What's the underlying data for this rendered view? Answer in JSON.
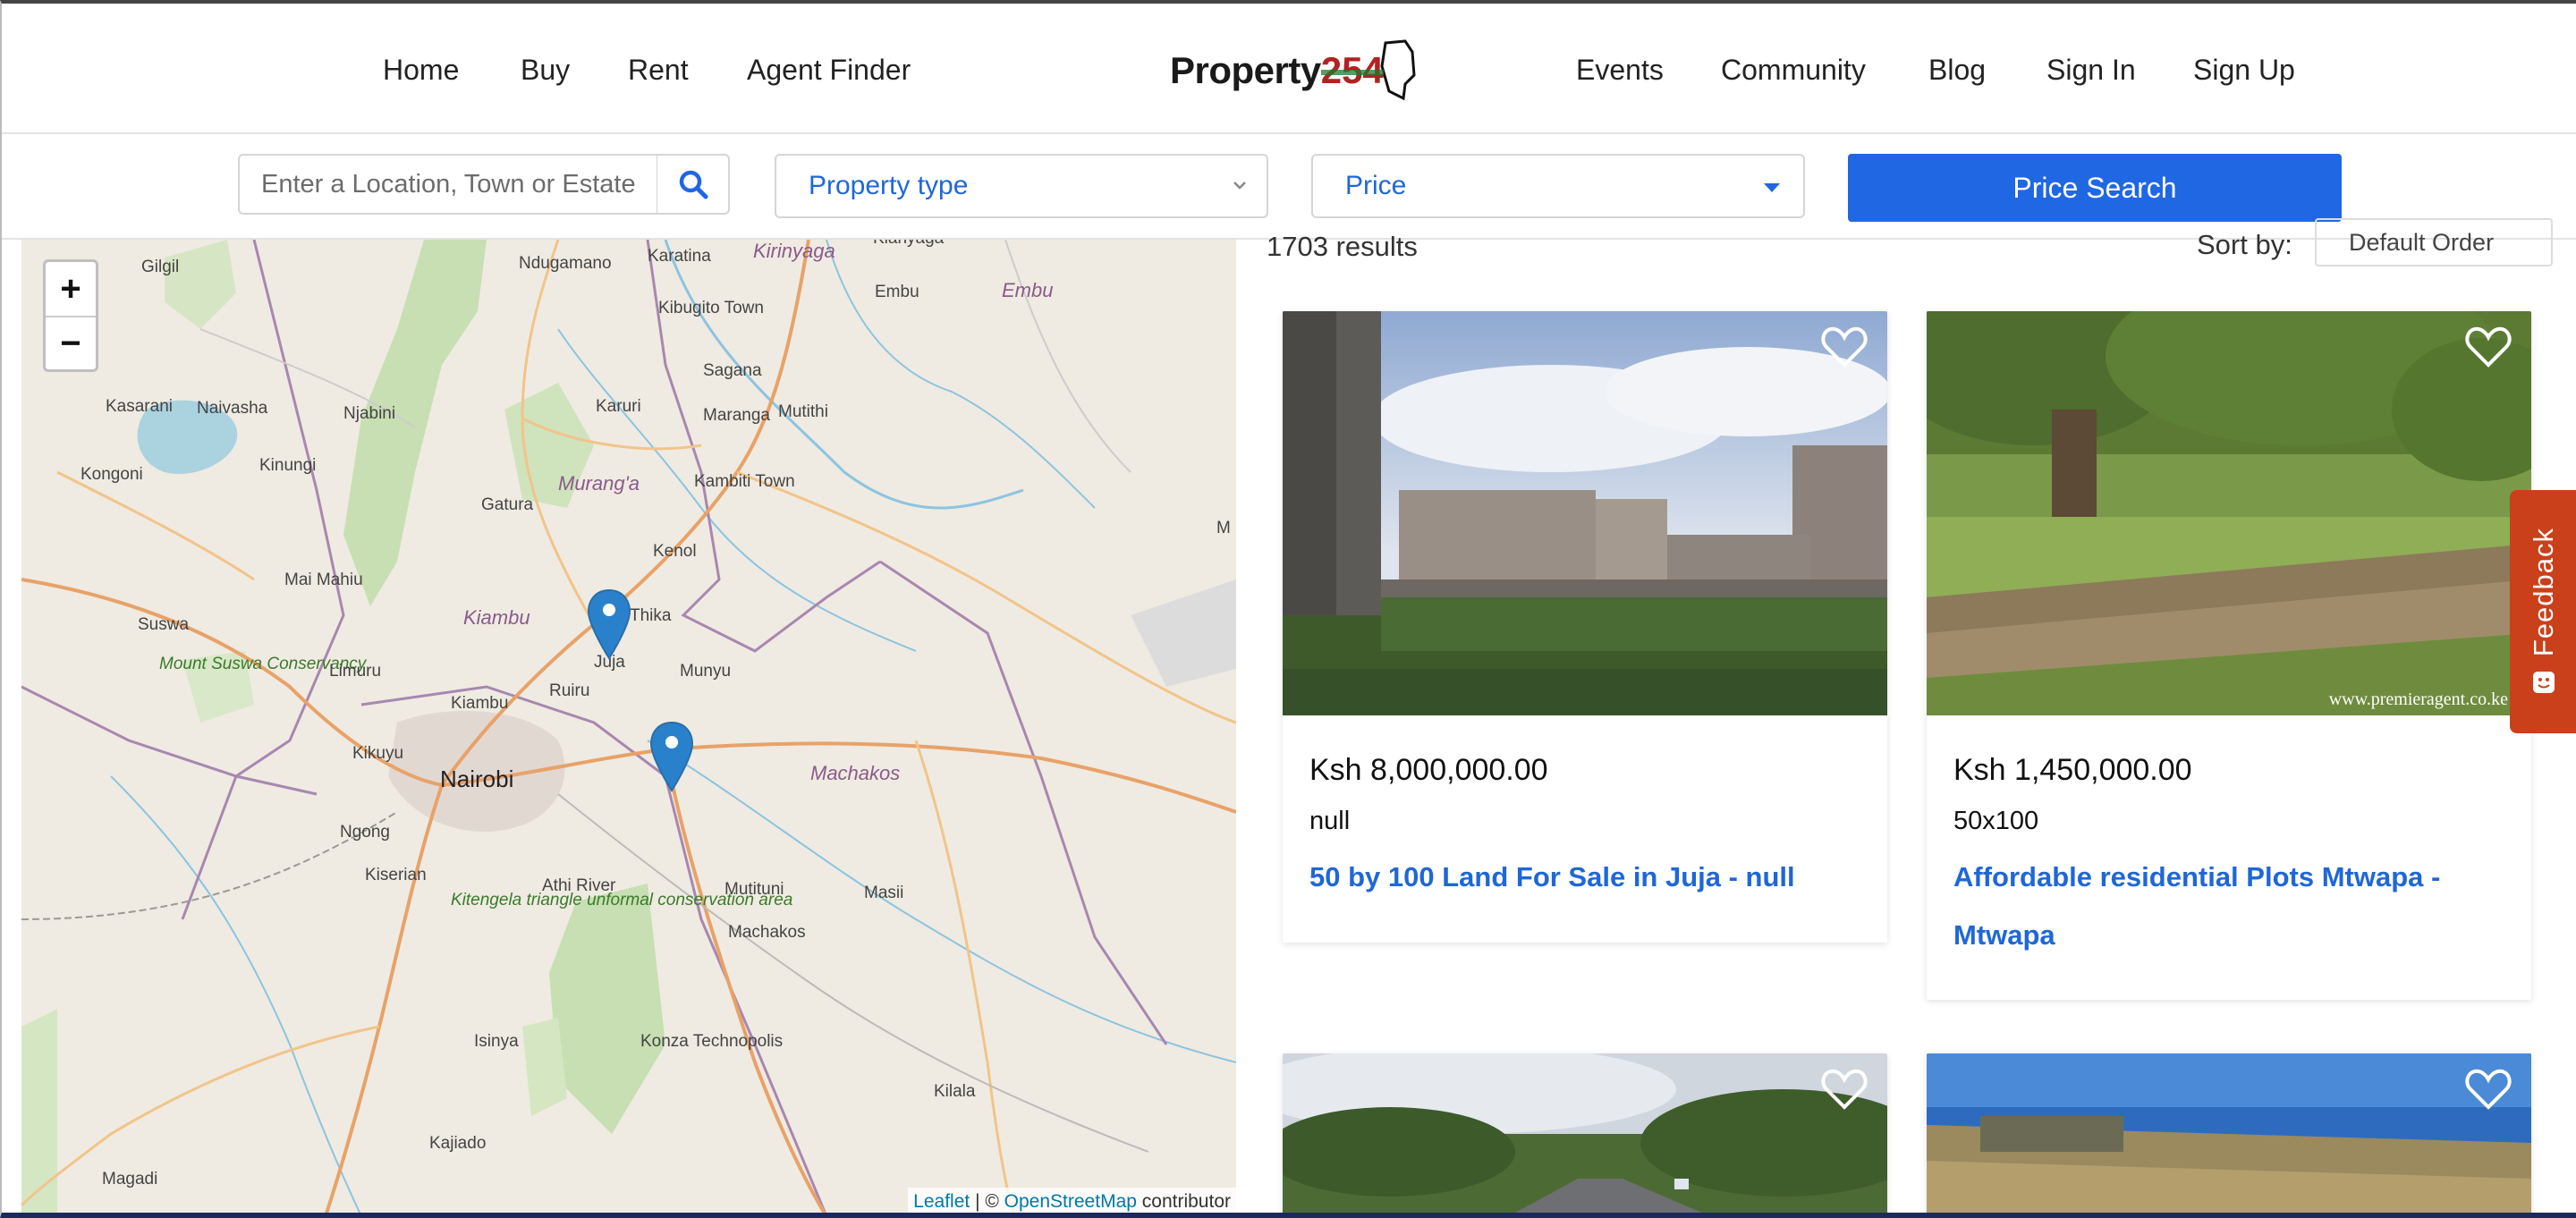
{
  "nav": {
    "left": [
      "Home",
      "Buy",
      "Rent",
      "Agent Finder"
    ],
    "right": [
      "Events",
      "Community",
      "Blog",
      "Sign In",
      "Sign Up"
    ],
    "logo_text": "Property",
    "logo_num": "254"
  },
  "search": {
    "location_placeholder": "Enter a Location, Town or Estate",
    "property_type": "Property type",
    "price": "Price",
    "price_search_label": "Price Search"
  },
  "map": {
    "zoom_in": "+",
    "zoom_out": "−",
    "places": {
      "ndugamano": "Ndugamano",
      "karatina": "Karatina",
      "kirinyaga": "Kirinyaga",
      "kianyaga": "Kianyaga",
      "embu_town": "Embu",
      "embu_county": "Embu",
      "kibugito": "Kibugito Town",
      "gilgil": "Gilgil",
      "kasarani": "Kasarani",
      "naivasha": "Naivasha",
      "njabini": "Njabini",
      "karuri": "Karuri",
      "maranga": "Maranga",
      "sagana": "Sagana",
      "mutithi": "Mutithi",
      "kongoni": "Kongoni",
      "kinungi": "Kinungi",
      "gatura": "Gatura",
      "muranga": "Murang'a",
      "kambiti": "Kambiti Town",
      "mwingi": "M",
      "kenol": "Kenol",
      "mai_mahiu": "Mai Mahiu",
      "kiambu_county": "Kiambu",
      "thika": "Thika",
      "suswa": "Suswa",
      "suswa_park": "Mount Suswa Conservancy",
      "limuru": "Limuru",
      "juja": "Juja",
      "ruiru": "Ruiru",
      "munyu": "Munyu",
      "kiambu": "Kiambu",
      "kikuyu": "Kikuyu",
      "nairobi": "Nairobi",
      "machakos_county": "Machakos",
      "ngong": "Ngong",
      "kiserian": "Kiserian",
      "athi_river": "Athi River",
      "kitengela": "Kitengela triangle unformal conservation area",
      "mutituni": "Mutituni",
      "masii": "Masii",
      "machakos": "Machakos",
      "isinya": "Isinya",
      "konza": "Konza Technopolis",
      "kilala": "Kilala",
      "kajiado": "Kajiado",
      "magadi": "Magadi"
    },
    "attribution_leaflet": "Leaflet",
    "attribution_sep": " | © ",
    "attribution_osm": "OpenStreetMap",
    "attribution_tail": " contributor"
  },
  "results": {
    "count_text": "1703 results",
    "sort_label": "Sort by:",
    "sort_value": "Default Order"
  },
  "listings": [
    {
      "price": "Ksh 8,000,000.00",
      "size": "null",
      "title": "50 by 100 Land For Sale in Juja - null"
    },
    {
      "price": "Ksh 1,450,000.00",
      "size": "50x100",
      "title": "Affordable residential Plots Mtwapa - Mtwapa",
      "watermark": "www.premieragent.co.ke"
    }
  ],
  "feedback": "Feedback",
  "colors": {
    "accent": "#1f67e3",
    "link": "#1f67d8",
    "feedback": "#c9401a",
    "marker": "#2a81cb"
  }
}
